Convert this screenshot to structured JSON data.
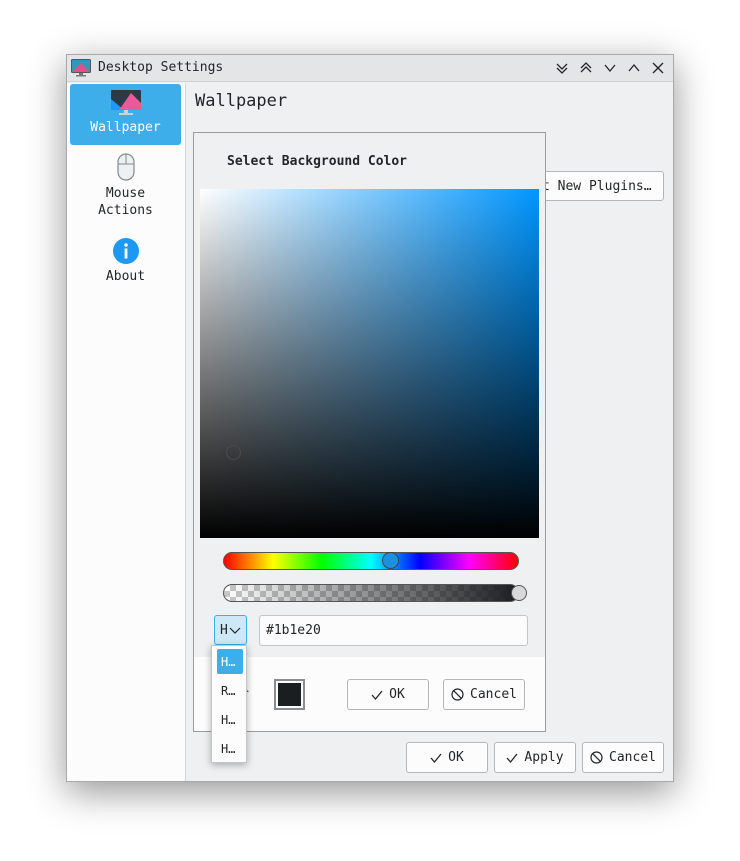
{
  "window": {
    "title": "Desktop Settings",
    "controls": [
      "keep-below-icon",
      "keep-above-icon",
      "minimize-icon",
      "maximize-icon",
      "close-icon"
    ]
  },
  "sidebar": {
    "items": [
      {
        "label": "Wallpaper",
        "icon": "monitor-icon",
        "selected": true
      },
      {
        "label": "Mouse\nActions",
        "icon": "mouse-icon",
        "selected": false
      },
      {
        "label": "About",
        "icon": "info-icon",
        "selected": false
      }
    ]
  },
  "page": {
    "title": "Wallpaper",
    "get_plugins_label": "t New Plugins…"
  },
  "color_dialog": {
    "title": "Select Background Color",
    "mode_label": "H",
    "hex_value": "#1b1e20",
    "color_label": "r",
    "current_color": "#1b1e20",
    "ok_label": "OK",
    "cancel_label": "Cancel",
    "mode_options": [
      "H…",
      "R…",
      "H…",
      "H…"
    ]
  },
  "footer": {
    "ok_label": "OK",
    "apply_label": "Apply",
    "cancel_label": "Cancel"
  },
  "colors": {
    "accent": "#3daee9",
    "field_hue": "#0096ff"
  }
}
